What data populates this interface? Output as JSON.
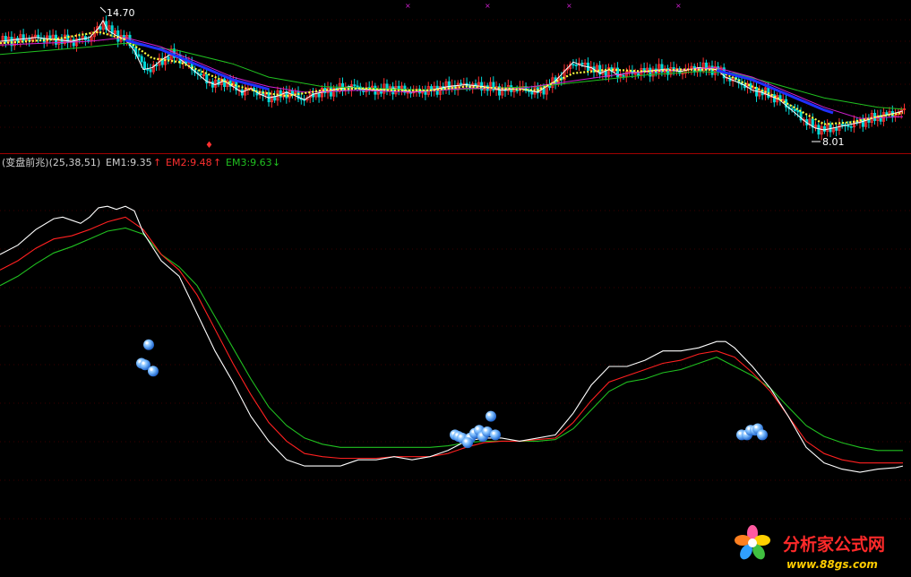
{
  "indicator": {
    "name": "(变盘前兆)(25,38,51)",
    "em1_label": "EM1:9.35",
    "em2_label": "EM2:9.48",
    "em3_label": "EM3:9.63",
    "em1_arrow": "↑",
    "em2_arrow": "↑",
    "em3_arrow": "↓"
  },
  "price_panel": {
    "high_label": "14.70",
    "low_label": "8.01"
  },
  "watermark": {
    "title": "分析家公式网",
    "url": "www.88gs.com"
  },
  "colors": {
    "em1": "#ffffff",
    "em2": "#ff2020",
    "em3": "#20c020",
    "ma_slow": "#20c020",
    "ma_mid": "#d020d0",
    "ma_fast": "#ffff40",
    "ma_dark": "#2030ff",
    "up": "#ff3030",
    "down": "#00d8d8",
    "ball": "#5aa8ff"
  },
  "chart_data": [
    {
      "type": "line",
      "panel": "price",
      "series": [
        {
          "name": "price_close",
          "x": [
            0,
            20,
            40,
            60,
            80,
            100,
            110,
            115,
            120,
            130,
            140,
            150,
            160,
            170,
            180,
            190,
            200,
            210,
            220,
            230,
            240,
            250,
            260,
            270,
            280,
            290,
            300,
            310,
            320,
            330,
            340,
            350,
            360,
            370,
            380,
            390,
            400,
            420,
            440,
            460,
            480,
            500,
            520,
            540,
            560,
            580,
            600,
            620,
            630,
            640,
            650,
            660,
            670,
            680,
            690,
            700,
            720,
            740,
            760,
            780,
            800,
            810,
            820,
            830,
            840,
            850,
            860,
            870,
            880,
            890,
            900,
            910,
            920,
            940,
            960,
            980,
            1000,
            1008
          ],
          "y": [
            13.3,
            13.4,
            13.5,
            13.4,
            13.3,
            13.5,
            14.0,
            14.4,
            13.9,
            13.6,
            13.4,
            12.8,
            11.8,
            11.9,
            12.3,
            12.6,
            12.4,
            12.0,
            11.6,
            11.2,
            11.0,
            11.2,
            10.9,
            10.6,
            10.8,
            10.5,
            10.3,
            10.4,
            10.6,
            10.4,
            10.2,
            10.5,
            10.6,
            10.7,
            10.8,
            10.9,
            10.8,
            10.7,
            10.8,
            10.6,
            10.7,
            10.9,
            11.0,
            10.9,
            10.7,
            10.8,
            10.6,
            11.2,
            11.7,
            12.2,
            12.0,
            11.9,
            11.6,
            11.8,
            11.5,
            11.6,
            11.7,
            11.8,
            11.7,
            11.9,
            11.8,
            11.4,
            11.2,
            11.0,
            10.7,
            10.6,
            10.4,
            10.2,
            9.8,
            9.4,
            9.0,
            8.7,
            8.6,
            8.8,
            9.0,
            9.3,
            9.5,
            9.6
          ]
        },
        {
          "name": "ma_slow",
          "x": [
            0,
            100,
            140,
            200,
            260,
            300,
            360,
            420,
            480,
            540,
            600,
            660,
            720,
            780,
            820,
            860,
            920,
            980,
            1008
          ],
          "y": [
            12.6,
            13.0,
            13.2,
            12.8,
            12.1,
            11.4,
            10.9,
            10.8,
            10.7,
            10.8,
            10.9,
            11.2,
            11.5,
            11.7,
            11.6,
            11.1,
            10.3,
            9.8,
            9.7
          ]
        },
        {
          "name": "ma_mid",
          "x": [
            0,
            100,
            140,
            180,
            220,
            260,
            300,
            340,
            400,
            460,
            520,
            580,
            640,
            700,
            760,
            800,
            840,
            880,
            920,
            960,
            1008
          ],
          "y": [
            13.1,
            13.3,
            13.5,
            13.0,
            12.2,
            11.4,
            10.9,
            10.6,
            10.7,
            10.6,
            10.8,
            10.8,
            11.2,
            11.6,
            11.8,
            11.9,
            11.4,
            10.6,
            9.8,
            9.2,
            9.3
          ]
        },
        {
          "name": "ma_fast",
          "x": [
            0,
            60,
            110,
            140,
            170,
            200,
            230,
            260,
            290,
            320,
            360,
            400,
            440,
            480,
            520,
            560,
            600,
            640,
            680,
            720,
            760,
            800,
            830,
            860,
            890,
            920,
            950,
            980,
            1008
          ],
          "y": [
            13.2,
            13.4,
            13.8,
            13.4,
            12.4,
            12.2,
            11.6,
            11.0,
            10.6,
            10.4,
            10.7,
            10.8,
            10.7,
            10.7,
            10.9,
            10.8,
            10.7,
            11.6,
            11.8,
            11.7,
            11.8,
            11.8,
            11.1,
            10.5,
            9.7,
            8.9,
            9.0,
            9.3,
            9.5
          ]
        }
      ],
      "markers": [
        {
          "label": "14.70",
          "x": 115,
          "y": 14.7
        },
        {
          "label": "8.01",
          "x": 905,
          "y": 8.01
        }
      ],
      "ylim": [
        7.6,
        15.3
      ],
      "xlim": [
        0,
        1017
      ]
    },
    {
      "type": "line",
      "panel": "indicator",
      "series": [
        {
          "name": "EM1",
          "x": [
            0,
            20,
            40,
            60,
            70,
            80,
            90,
            100,
            110,
            120,
            130,
            140,
            150,
            160,
            180,
            200,
            220,
            240,
            260,
            280,
            300,
            320,
            340,
            360,
            380,
            400,
            420,
            440,
            460,
            480,
            500,
            520,
            540,
            560,
            580,
            600,
            620,
            640,
            660,
            680,
            700,
            720,
            740,
            760,
            780,
            800,
            810,
            820,
            840,
            860,
            880,
            900,
            920,
            940,
            960,
            980,
            1000,
            1008
          ],
          "y": [
            9.82,
            9.88,
            9.98,
            10.05,
            10.06,
            10.04,
            10.02,
            10.06,
            10.12,
            10.13,
            10.11,
            10.13,
            10.1,
            9.96,
            9.78,
            9.68,
            9.44,
            9.2,
            9.0,
            8.78,
            8.62,
            8.5,
            8.46,
            8.46,
            8.46,
            8.5,
            8.5,
            8.52,
            8.5,
            8.52,
            8.56,
            8.62,
            8.64,
            8.64,
            8.62,
            8.64,
            8.66,
            8.8,
            8.98,
            9.1,
            9.1,
            9.14,
            9.2,
            9.2,
            9.22,
            9.26,
            9.26,
            9.22,
            9.1,
            8.96,
            8.78,
            8.58,
            8.48,
            8.44,
            8.42,
            8.44,
            8.45,
            8.46
          ]
        },
        {
          "name": "EM2",
          "x": [
            0,
            20,
            40,
            60,
            80,
            100,
            120,
            140,
            160,
            180,
            200,
            220,
            240,
            260,
            280,
            300,
            320,
            340,
            360,
            380,
            400,
            420,
            440,
            460,
            480,
            500,
            520,
            540,
            560,
            580,
            600,
            620,
            640,
            660,
            680,
            700,
            720,
            740,
            760,
            780,
            800,
            820,
            840,
            860,
            880,
            900,
            920,
            940,
            960,
            980,
            1000,
            1008
          ],
          "y": [
            9.72,
            9.78,
            9.86,
            9.92,
            9.94,
            9.98,
            10.03,
            10.06,
            9.98,
            9.82,
            9.72,
            9.56,
            9.34,
            9.12,
            8.92,
            8.74,
            8.62,
            8.54,
            8.52,
            8.51,
            8.51,
            8.51,
            8.52,
            8.52,
            8.52,
            8.54,
            8.58,
            8.61,
            8.62,
            8.62,
            8.63,
            8.64,
            8.74,
            8.88,
            9.0,
            9.04,
            9.08,
            9.12,
            9.14,
            9.18,
            9.2,
            9.16,
            9.06,
            8.94,
            8.78,
            8.62,
            8.54,
            8.5,
            8.48,
            8.48,
            8.48,
            8.48
          ]
        },
        {
          "name": "EM3",
          "x": [
            0,
            20,
            40,
            60,
            80,
            100,
            120,
            140,
            160,
            180,
            200,
            220,
            240,
            260,
            280,
            300,
            320,
            340,
            360,
            380,
            400,
            420,
            440,
            460,
            480,
            500,
            520,
            540,
            560,
            580,
            600,
            620,
            640,
            660,
            680,
            700,
            720,
            740,
            760,
            780,
            800,
            820,
            840,
            860,
            880,
            900,
            920,
            940,
            960,
            980,
            1000,
            1008
          ],
          "y": [
            9.62,
            9.68,
            9.76,
            9.83,
            9.87,
            9.92,
            9.97,
            9.99,
            9.95,
            9.82,
            9.74,
            9.62,
            9.42,
            9.22,
            9.02,
            8.84,
            8.72,
            8.64,
            8.6,
            8.58,
            8.58,
            8.58,
            8.58,
            8.58,
            8.58,
            8.59,
            8.61,
            8.62,
            8.62,
            8.62,
            8.62,
            8.63,
            8.7,
            8.82,
            8.94,
            9.0,
            9.02,
            9.06,
            9.08,
            9.12,
            9.16,
            9.1,
            9.04,
            8.96,
            8.84,
            8.72,
            8.65,
            8.61,
            8.58,
            8.56,
            8.56,
            8.56
          ]
        }
      ],
      "signals": [
        {
          "x": 166,
          "y": 9.24
        },
        {
          "x": 158,
          "y": 9.12
        },
        {
          "x": 162,
          "y": 9.11
        },
        {
          "x": 171,
          "y": 9.07
        },
        {
          "x": 508,
          "y": 8.66
        },
        {
          "x": 512,
          "y": 8.65
        },
        {
          "x": 516,
          "y": 8.64
        },
        {
          "x": 525,
          "y": 8.64
        },
        {
          "x": 530,
          "y": 8.67
        },
        {
          "x": 535,
          "y": 8.69
        },
        {
          "x": 539,
          "y": 8.65
        },
        {
          "x": 544,
          "y": 8.68
        },
        {
          "x": 548,
          "y": 8.78
        },
        {
          "x": 553,
          "y": 8.66
        },
        {
          "x": 522,
          "y": 8.61
        },
        {
          "x": 828,
          "y": 8.66
        },
        {
          "x": 834,
          "y": 8.66
        },
        {
          "x": 838,
          "y": 8.69
        },
        {
          "x": 843,
          "y": 8.69
        },
        {
          "x": 846,
          "y": 8.7
        },
        {
          "x": 851,
          "y": 8.66
        }
      ],
      "ylim": [
        8.0,
        10.35
      ],
      "xlim": [
        0,
        1017
      ]
    }
  ]
}
